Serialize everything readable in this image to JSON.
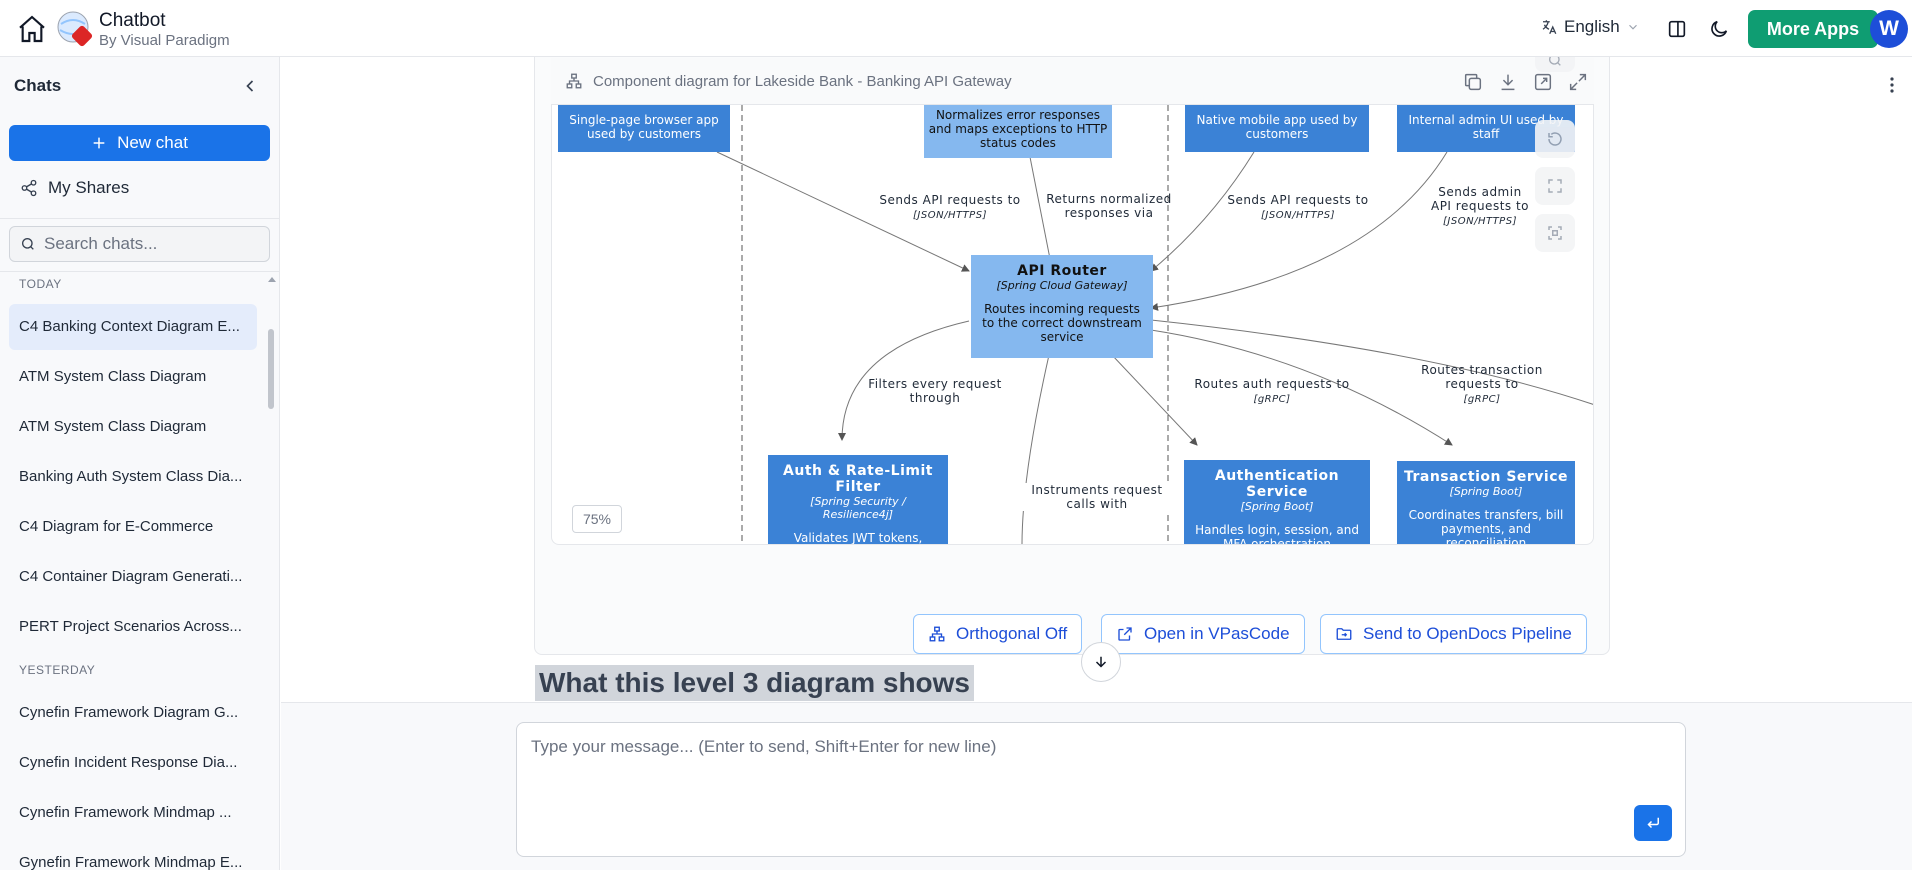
{
  "header": {
    "title": "Chatbot",
    "subtitle": "By Visual Paradigm",
    "language": "English",
    "more_apps_label": "More Apps",
    "avatar_initial": "W"
  },
  "sidebar": {
    "title": "Chats",
    "new_chat_label": "New chat",
    "my_shares_label": "My Shares",
    "search_placeholder": "Search chats...",
    "sections": [
      {
        "label": "TODAY",
        "items": [
          "C4 Banking Context Diagram E...",
          "ATM System Class Diagram",
          "ATM System Class Diagram",
          "Banking Auth System Class Dia...",
          "C4 Diagram for E-Commerce",
          "C4 Container Diagram Generati...",
          "PERT Project Scenarios Across..."
        ]
      },
      {
        "label": "YESTERDAY",
        "items": [
          "Cynefin Framework Diagram G...",
          "Cynefin Incident Response Dia...",
          "Cynefin Framework Mindmap ...",
          "Gynefin Framework Mindmap E..."
        ]
      }
    ]
  },
  "diagram": {
    "title": "Component diagram for Lakeside Bank - Banking API Gateway",
    "zoom": "75%",
    "nodes": {
      "spa": {
        "desc": "Single-page browser app used by customers"
      },
      "error": {
        "desc": "Normalizes error responses and maps exceptions to HTTP status codes"
      },
      "mobile": {
        "desc": "Native mobile app used by customers"
      },
      "admin": {
        "desc": "Internal admin UI used by staff"
      },
      "router": {
        "title": "API Router",
        "tech": "[Spring Cloud Gateway]",
        "desc": "Routes incoming requests to the correct downstream service"
      },
      "auth_filter": {
        "title": "Auth & Rate-Limit Filter",
        "tech": "[Spring Security / Resilience4j]",
        "desc": "Validates JWT tokens, applies rate limits, and checks permissions"
      },
      "authn": {
        "title": "Authentication Service",
        "tech": "[Spring Boot]",
        "desc": "Handles login, session, and MFA orchestration"
      },
      "txn": {
        "title": "Transaction Service",
        "tech": "[Spring Boot]",
        "desc": "Coordinates transfers, bill payments, and reconciliation"
      }
    },
    "edges": {
      "e1": {
        "label": "Sends API requests to",
        "tech": "[JSON/HTTPS]"
      },
      "e2": {
        "label": "Returns normalized responses via",
        "tech": ""
      },
      "e3": {
        "label": "Sends API requests to",
        "tech": "[JSON/HTTPS]"
      },
      "e4": {
        "label": "Sends admin API requests to",
        "tech": "[JSON/HTTPS]"
      },
      "e5": {
        "label": "Filters every request through",
        "tech": ""
      },
      "e6": {
        "label": "Routes auth requests to",
        "tech": "[gRPC]"
      },
      "e7": {
        "label": "Routes transaction requests to",
        "tech": "[gRPC]"
      },
      "e8": {
        "label": "Instruments request calls with",
        "tech": ""
      }
    }
  },
  "actions": {
    "orthogonal_label": "Orthogonal Off",
    "vpascode_label": "Open in VPasCode",
    "opendocs_label": "Send to OpenDocs Pipeline"
  },
  "content": {
    "section_heading": "What this level 3 diagram shows"
  },
  "composer": {
    "placeholder": "Type your message... (Enter to send, Shift+Enter for new line)"
  },
  "colors": {
    "primary": "#1a73e8",
    "more_apps": "#0f9d72",
    "node_dark": "#3b82d6",
    "node_light": "#85b8ef"
  }
}
